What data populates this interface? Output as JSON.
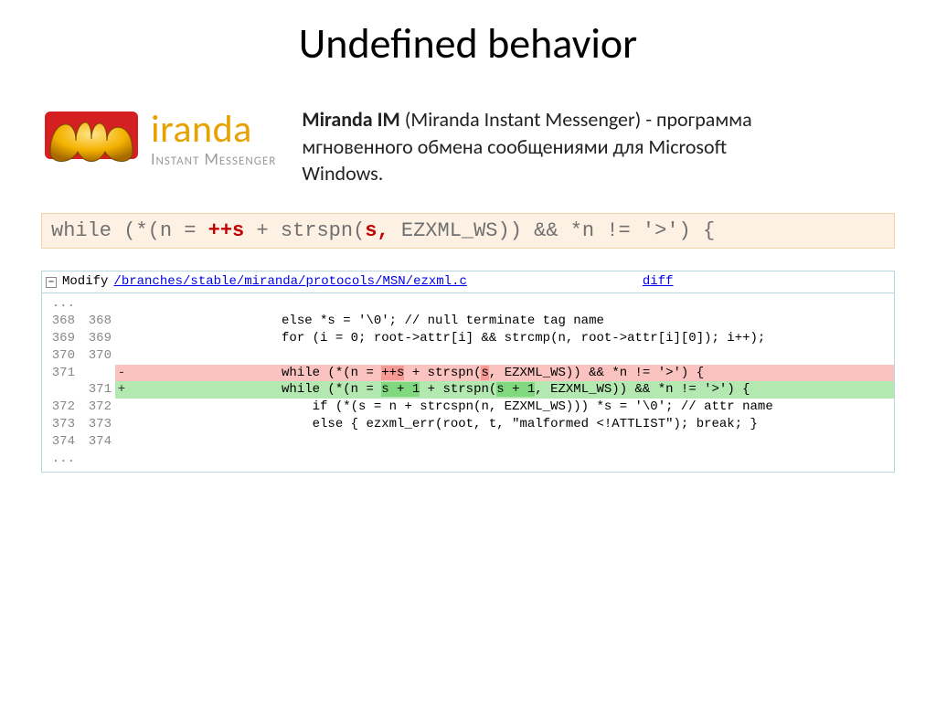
{
  "title": "Undefined behavior",
  "logo": {
    "word": "iranda",
    "sub": "Instant Messenger"
  },
  "desc": {
    "bold": "Miranda IM",
    "rest": " (Miranda Instant Messenger) - программа мгновенного обмена сообщениями для Microsoft Windows."
  },
  "snippet": {
    "p1": "while (*(n = ",
    "p2": "++s",
    "p3": " + strspn(",
    "p4": "s",
    "p5": ",",
    "p6": " EZXML_WS)) && *n != '>') {"
  },
  "diff": {
    "modifyLabel": "Modify",
    "path": "/branches/stable/miranda/protocols/MSN/ezxml.c",
    "diffLink": "diff",
    "rows": [
      {
        "l": "...",
        "r": "",
        "s": " ",
        "code": "",
        "cls": ""
      },
      {
        "l": "368",
        "r": "368",
        "s": " ",
        "code": "                    else *s = '\\0'; // null terminate tag name",
        "cls": ""
      },
      {
        "l": "369",
        "r": "369",
        "s": " ",
        "code": "                    for (i = 0; root->attr[i] && strcmp(n, root->attr[i][0]); i++);",
        "cls": ""
      },
      {
        "l": "370",
        "r": "370",
        "s": " ",
        "code": "",
        "cls": ""
      },
      {
        "l": "371",
        "r": "",
        "s": "-",
        "code": "                    while (*(n = |++s| + strspn(|s|, EZXML_WS)) && *n != '>') {",
        "cls": "row-del"
      },
      {
        "l": "",
        "r": "371",
        "s": "+",
        "code": "                    while (*(n = |s + 1| + strspn(|s + 1|, EZXML_WS)) && *n != '>') {",
        "cls": "row-add"
      },
      {
        "l": "372",
        "r": "372",
        "s": " ",
        "code": "                        if (*(s = n + strcspn(n, EZXML_WS))) *s = '\\0'; // attr name",
        "cls": ""
      },
      {
        "l": "373",
        "r": "373",
        "s": " ",
        "code": "                        else { ezxml_err(root, t, \"malformed <!ATTLIST\"); break; }",
        "cls": ""
      },
      {
        "l": "374",
        "r": "374",
        "s": " ",
        "code": "",
        "cls": ""
      },
      {
        "l": "...",
        "r": "",
        "s": " ",
        "code": "",
        "cls": ""
      }
    ]
  }
}
